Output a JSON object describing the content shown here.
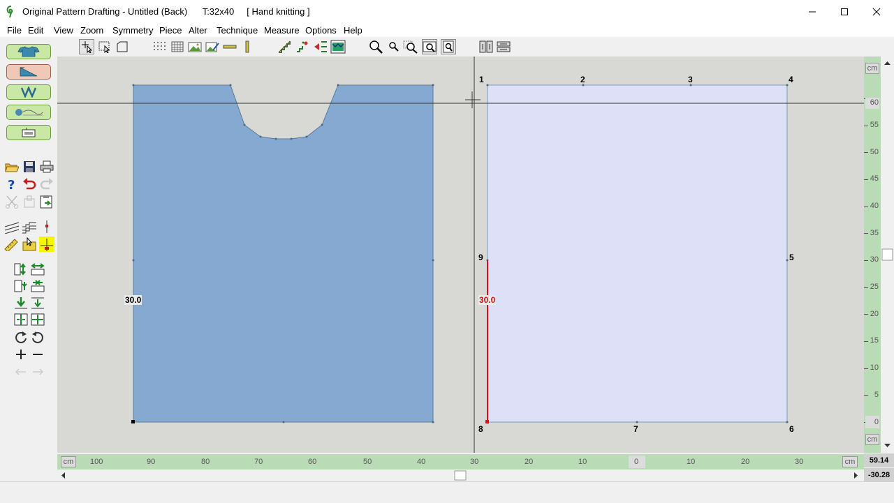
{
  "window": {
    "title": "Original Pattern Drafting - Untitled (Back)      T:32x40     [ Hand knitting ]"
  },
  "menu": [
    "File",
    "Edit",
    "View",
    "Zoom",
    "Symmetry",
    "Piece",
    "Alter",
    "Technique",
    "Measure",
    "Options",
    "Help"
  ],
  "canvas": {
    "left_piece": {
      "fill": "#85a9d0",
      "label": "30.0"
    },
    "right_piece": {
      "fill": "#dee0f8",
      "label": "30.0",
      "label_color": "#d21414",
      "point_labels": [
        "1",
        "2",
        "3",
        "4",
        "5",
        "6",
        "7",
        "8",
        "9"
      ]
    }
  },
  "vruler": {
    "unit": "cm",
    "ticks": [
      "60",
      "55",
      "50",
      "45",
      "40",
      "35",
      "30",
      "25",
      "20",
      "15",
      "10",
      "5",
      "0"
    ]
  },
  "hruler": {
    "unit": "cm",
    "ticks": [
      "100",
      "90",
      "80",
      "70",
      "60",
      "50",
      "40",
      "30",
      "20",
      "10",
      "0",
      "10",
      "20",
      "30"
    ]
  },
  "coords": {
    "y": "59.14",
    "x": "-30.28"
  }
}
